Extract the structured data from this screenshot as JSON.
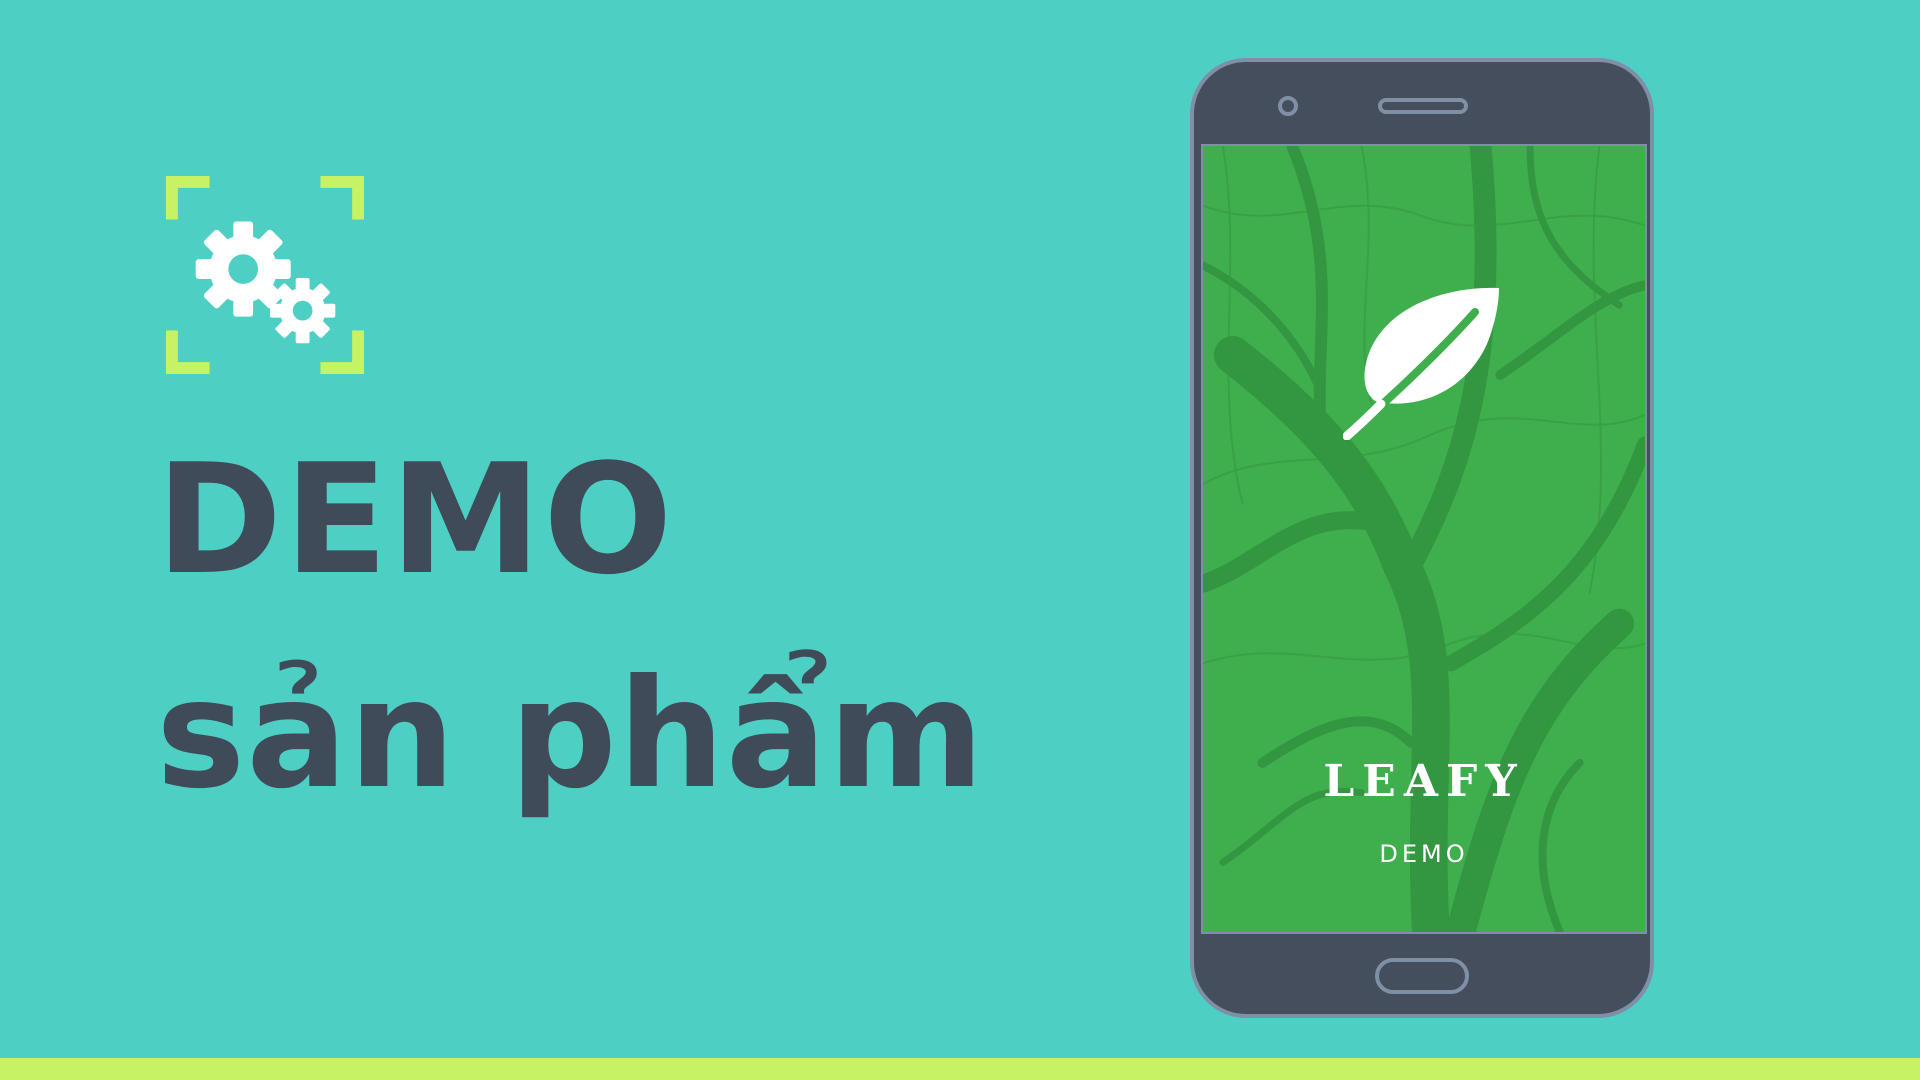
{
  "headline": {
    "line1": "DEMO",
    "line2": "sản phẩm"
  },
  "icons": {
    "settings": "settings-gears-icon",
    "leaf": "leaf-icon"
  },
  "phone": {
    "screen": {
      "app_name": "LEAFY",
      "subtitle": "DEMO"
    }
  },
  "colors": {
    "background": "#4ecfc4",
    "accent": "#c6f264",
    "text": "#404b59",
    "phone_body": "#454e5c",
    "phone_outline": "#7f8fa5",
    "screen_green": "#3fae4d"
  }
}
